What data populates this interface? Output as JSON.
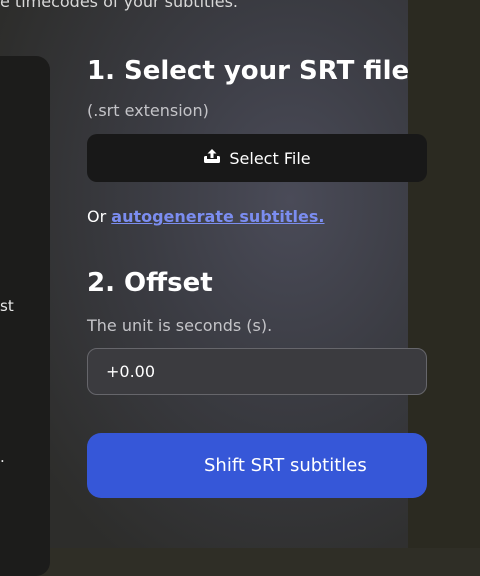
{
  "header": {
    "subtitle_fragment": "e timecodes of your subtitles."
  },
  "left_panel": {
    "fragment_1": "st",
    "fragment_2": "."
  },
  "step1": {
    "title": "1.  Select your SRT file",
    "hint": "(.srt extension)",
    "select_button": {
      "label": "Select File",
      "icon": "upload-icon"
    },
    "or_text": "Or ",
    "autogenerate_link": "autogenerate subtitles."
  },
  "step2": {
    "title": "2. Offset",
    "hint": "The unit is seconds (s).",
    "offset_value": "+0.00"
  },
  "action": {
    "shift_button": "Shift SRT subtitles"
  }
}
